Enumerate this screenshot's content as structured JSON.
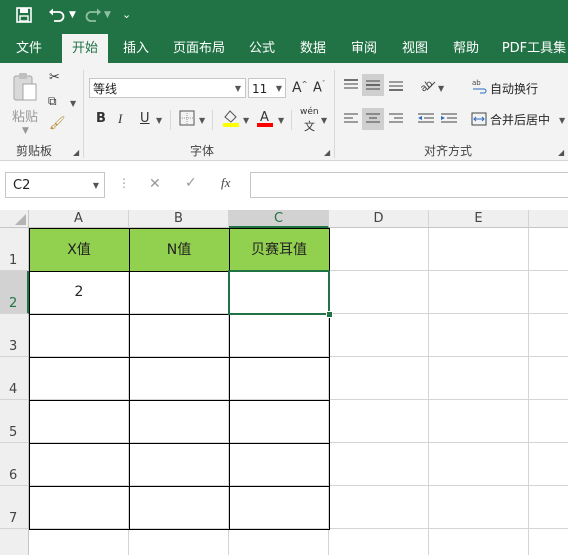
{
  "qat": {
    "save_icon": "save-icon",
    "undo_icon": "undo-icon",
    "redo_icon": "redo-icon",
    "customize_icon": "customize-icon"
  },
  "tabs": [
    {
      "label": "文件"
    },
    {
      "label": "开始"
    },
    {
      "label": "插入"
    },
    {
      "label": "页面布局"
    },
    {
      "label": "公式"
    },
    {
      "label": "数据"
    },
    {
      "label": "审阅"
    },
    {
      "label": "视图"
    },
    {
      "label": "帮助"
    },
    {
      "label": "PDF工具集"
    }
  ],
  "ribbon": {
    "clipboard": {
      "paste_label": "粘贴",
      "group_label": "剪贴板"
    },
    "font": {
      "font_name": "等线",
      "font_size": "11",
      "bold": "B",
      "italic": "I",
      "underline": "U",
      "phonetic": "wén",
      "group_label": "字体",
      "fill_color": "#ffff00",
      "font_color": "#ff0000"
    },
    "alignment": {
      "wrap_text": "自动换行",
      "merge_center": "合并后居中",
      "group_label": "对齐方式"
    }
  },
  "formula_bar": {
    "name_box": "C2",
    "cancel": "✕",
    "enter": "✓",
    "fx": "fx",
    "content": ""
  },
  "sheet": {
    "columns": [
      "A",
      "B",
      "C",
      "D",
      "E"
    ],
    "rows": [
      "1",
      "2",
      "3",
      "4",
      "5",
      "6",
      "7"
    ],
    "header_cells": [
      "X值",
      "N值",
      "贝赛耳值"
    ],
    "a2_value": "2",
    "header_fill": "#92d050",
    "accent": "#217346"
  }
}
